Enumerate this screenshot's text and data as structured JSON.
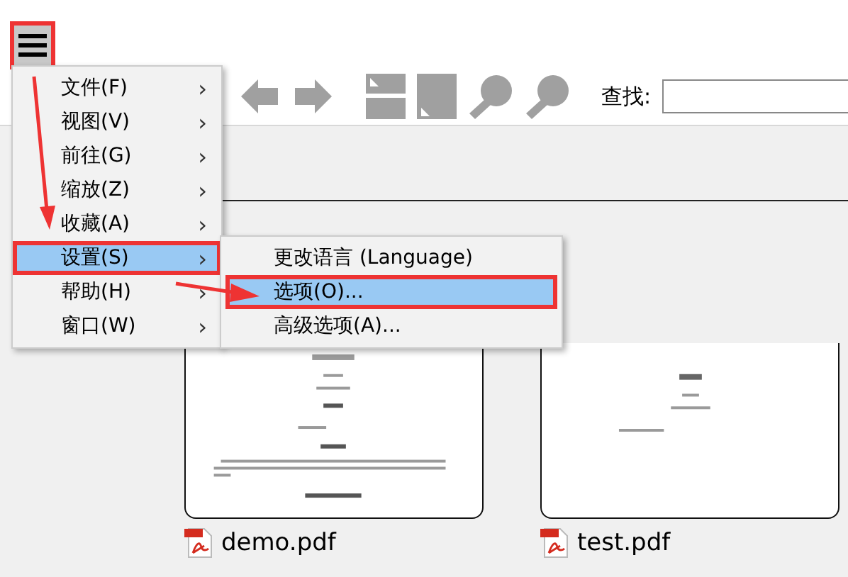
{
  "menu_button": {
    "annotated": true
  },
  "toolbar": {
    "search_label": "查找:"
  },
  "main_menu": [
    {
      "label": "文件(F)",
      "arrow": "›",
      "selected": false,
      "annotated": false
    },
    {
      "label": "视图(V)",
      "arrow": "›",
      "selected": false,
      "annotated": false
    },
    {
      "label": "前往(G)",
      "arrow": "›",
      "selected": false,
      "annotated": false
    },
    {
      "label": "缩放(Z)",
      "arrow": "›",
      "selected": false,
      "annotated": false
    },
    {
      "label": "收藏(A)",
      "arrow": "›",
      "selected": false,
      "annotated": false
    },
    {
      "label": "设置(S)",
      "arrow": "›",
      "selected": true,
      "annotated": true
    },
    {
      "label": "帮助(H)",
      "arrow": "›",
      "selected": false,
      "annotated": false
    },
    {
      "label": "窗口(W)",
      "arrow": "›",
      "selected": false,
      "annotated": false
    }
  ],
  "submenu": [
    {
      "label": "更改语言 (Language)",
      "selected": false,
      "annotated": false
    },
    {
      "label": "选项(O)...",
      "selected": true,
      "annotated": true
    },
    {
      "label": "高级选项(A)...",
      "selected": false,
      "annotated": false
    }
  ],
  "files": [
    {
      "name": "demo.pdf",
      "kind": "long"
    },
    {
      "name": "test.pdf",
      "kind": "short"
    }
  ]
}
